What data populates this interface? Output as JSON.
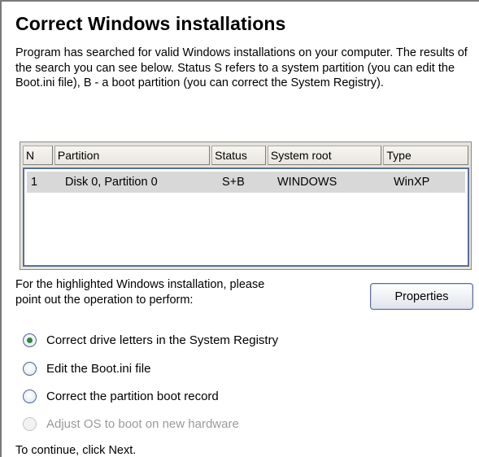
{
  "page": {
    "title": "Correct Windows installations",
    "description": "Program has searched for valid Windows installations on your computer. The results of the search you can see below. Status S refers to a system partition (you can edit the Boot.ini file), B - a boot partition (you can correct the System Registry)."
  },
  "table": {
    "columns": [
      "N",
      "Partition",
      "Status",
      "System root",
      "Type"
    ],
    "rows": [
      {
        "n": "1",
        "partition": "Disk 0, Partition 0",
        "status": "S+B",
        "system_root": "WINDOWS",
        "type": "WinXP",
        "selected": true
      }
    ]
  },
  "operation": {
    "hint_line1": "For the highlighted Windows installation, please",
    "hint_line2": "point out the operation to perform:",
    "properties_label": "Properties",
    "options": [
      {
        "label": "Correct drive letters in the System Registry",
        "checked": true,
        "enabled": true
      },
      {
        "label": "Edit the Boot.ini file",
        "checked": false,
        "enabled": true
      },
      {
        "label": "Correct the partition boot record",
        "checked": false,
        "enabled": true
      },
      {
        "label": "Adjust OS to boot on new hardware",
        "checked": false,
        "enabled": false
      }
    ]
  },
  "footer": {
    "text": "To continue, click Next."
  },
  "colors": {
    "selection_row": "#d8d8d8",
    "table_border": "#5a6f96",
    "radio_dot": "#2f8a35"
  }
}
